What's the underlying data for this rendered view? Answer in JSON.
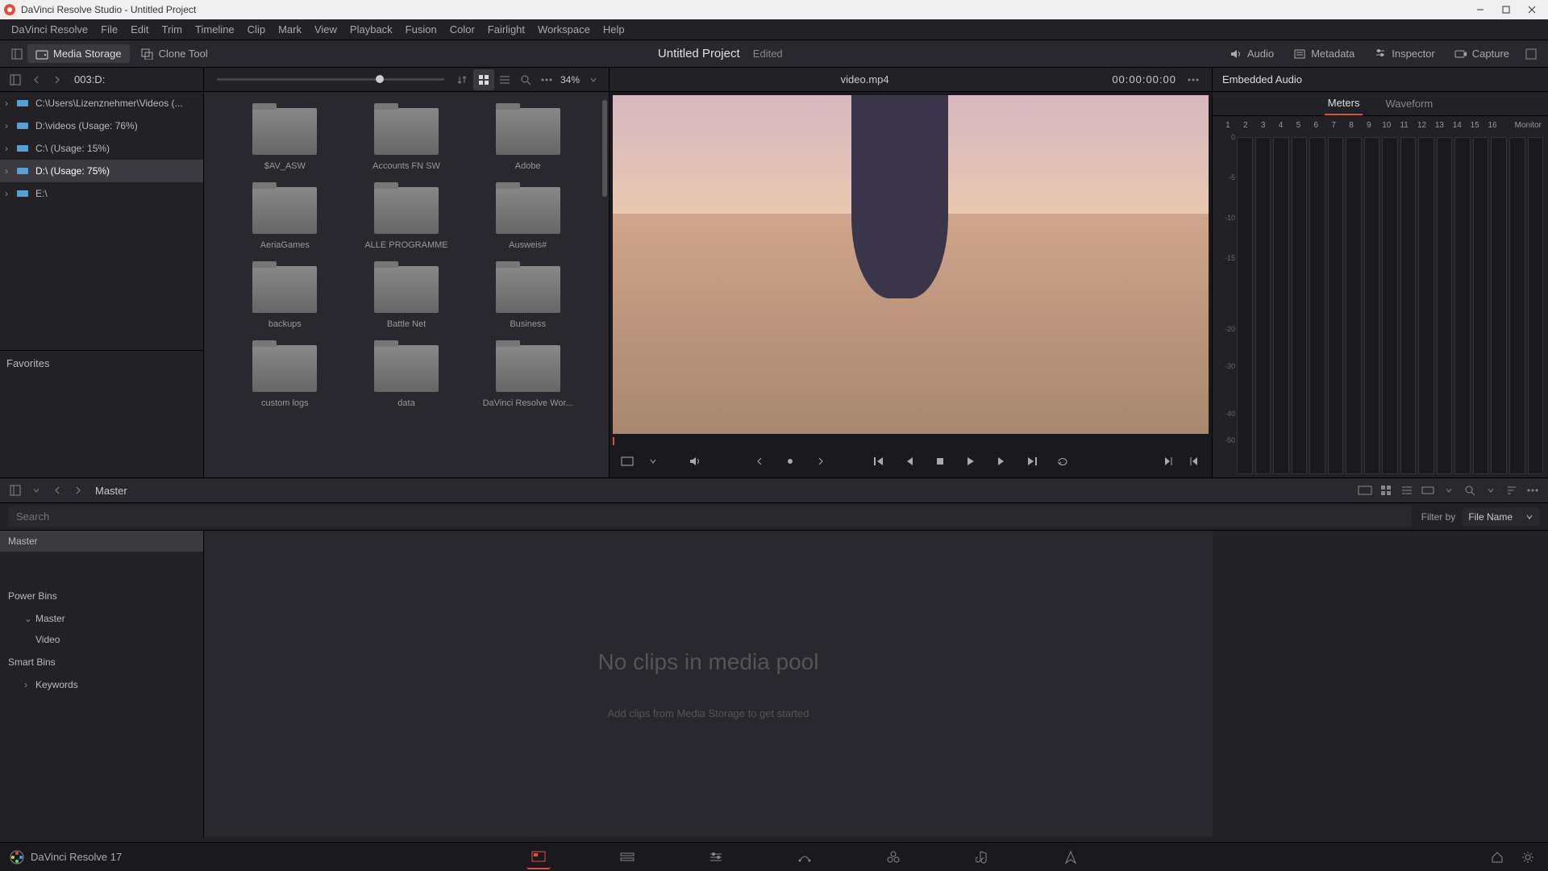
{
  "window": {
    "title": "DaVinci Resolve Studio - Untitled Project"
  },
  "menu": [
    "DaVinci Resolve",
    "File",
    "Edit",
    "Trim",
    "Timeline",
    "Clip",
    "Mark",
    "View",
    "Playback",
    "Fusion",
    "Color",
    "Fairlight",
    "Workspace",
    "Help"
  ],
  "top_toolbar": {
    "media_storage": "Media Storage",
    "clone_tool": "Clone Tool",
    "project_title": "Untitled Project",
    "edited": "Edited",
    "audio": "Audio",
    "metadata": "Metadata",
    "inspector": "Inspector",
    "capture": "Capture"
  },
  "browser": {
    "path": "003:D:",
    "zoom": "34%",
    "drives": [
      {
        "label": "C:\\Users\\Lizenznehmer\\Videos (...",
        "selected": false
      },
      {
        "label": "D:\\videos (Usage: 76%)",
        "selected": false
      },
      {
        "label": "C:\\ (Usage: 15%)",
        "selected": false
      },
      {
        "label": "D:\\ (Usage: 75%)",
        "selected": true
      },
      {
        "label": "E:\\",
        "selected": false
      }
    ],
    "favorites_header": "Favorites",
    "folders": [
      "$AV_ASW",
      "Accounts FN SW",
      "Adobe",
      "AeriaGames",
      "ALLE PROGRAMME",
      "Ausweis#",
      "backups",
      "Battle Net",
      "Business",
      "custom logs",
      "data",
      "DaVinci Resolve Wor..."
    ]
  },
  "viewer": {
    "clip_name": "video.mp4",
    "timecode": "00:00:00:00"
  },
  "audio_panel": {
    "title": "Embedded Audio",
    "tabs": {
      "meters": "Meters",
      "waveform": "Waveform"
    },
    "channels": [
      "1",
      "2",
      "3",
      "4",
      "5",
      "6",
      "7",
      "8",
      "9",
      "10",
      "11",
      "12",
      "13",
      "14",
      "15",
      "16"
    ],
    "monitor": "Monitor",
    "db_ticks": [
      {
        "v": "0",
        "pct": 0
      },
      {
        "v": "-5",
        "pct": 12
      },
      {
        "v": "-10",
        "pct": 24
      },
      {
        "v": "-15",
        "pct": 36
      },
      {
        "v": "-20",
        "pct": 57
      },
      {
        "v": "-30",
        "pct": 68
      },
      {
        "v": "-40",
        "pct": 82
      },
      {
        "v": "-50",
        "pct": 90
      }
    ]
  },
  "pool": {
    "master": "Master",
    "search_placeholder": "Search",
    "filter_by": "Filter by",
    "filter_value": "File Name",
    "master_bin": "Master",
    "power_bins": "Power Bins",
    "pb_master": "Master",
    "pb_video": "Video",
    "smart_bins": "Smart Bins",
    "keywords": "Keywords",
    "empty_title": "No clips in media pool",
    "empty_sub": "Add clips from Media Storage to get started"
  },
  "bottom": {
    "version": "DaVinci Resolve 17"
  }
}
